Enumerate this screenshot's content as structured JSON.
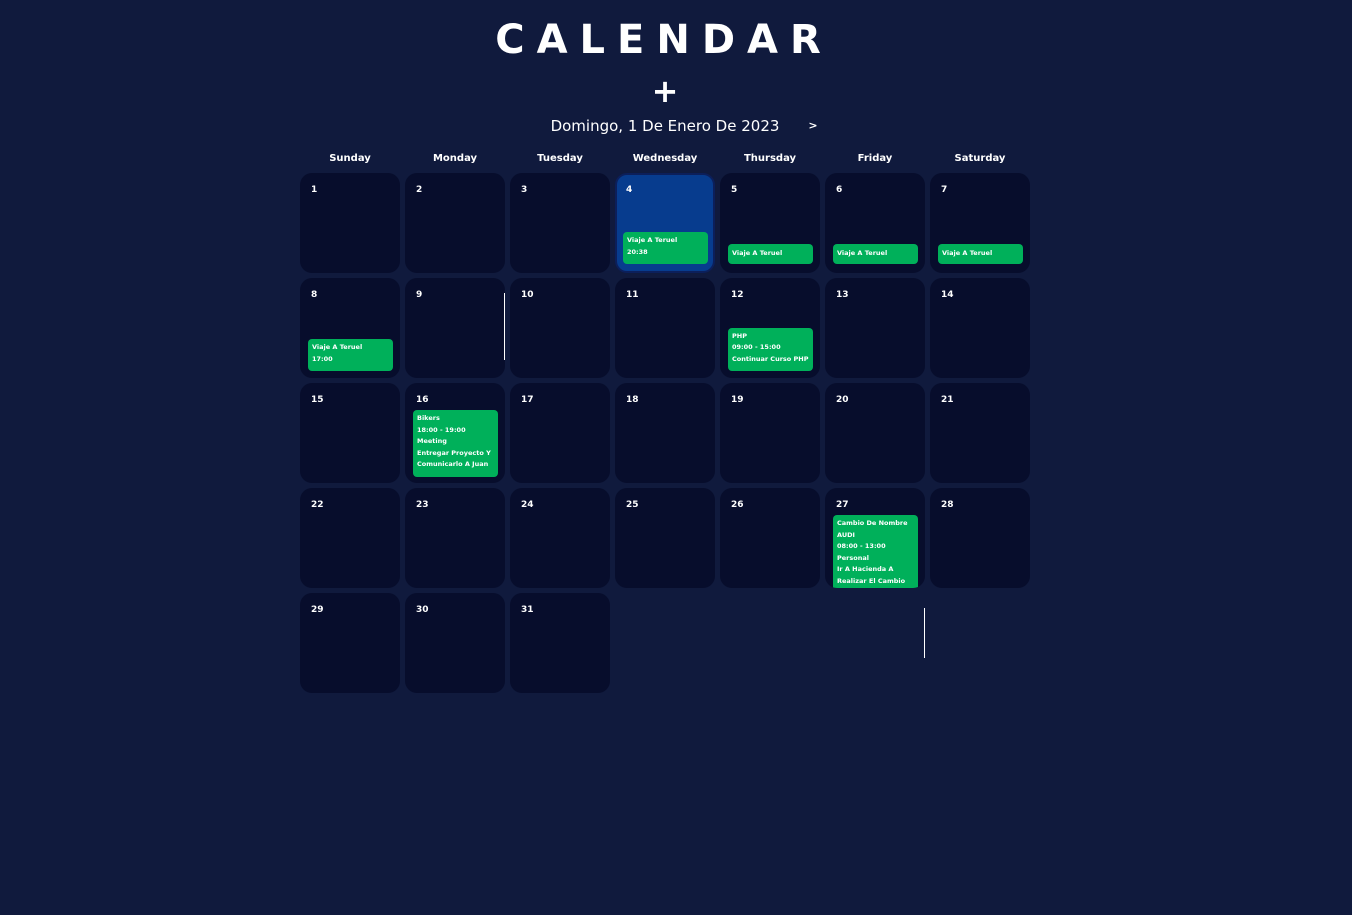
{
  "title": "CALENDAR",
  "add_icon": "plus-icon",
  "add_label": "+",
  "current_date": "Domingo, 1 De Enero De 2023",
  "next_label": ">",
  "weekdays": [
    "Sunday",
    "Monday",
    "Tuesday",
    "Wednesday",
    "Thursday",
    "Friday",
    "Saturday"
  ],
  "colors": {
    "background": "#101a3d",
    "cell": "#070d2c",
    "today_cell": "#073c8e",
    "event": "#00b05a",
    "text": "#ffffff"
  },
  "today": 4,
  "days": [
    {
      "n": "1",
      "events": []
    },
    {
      "n": "2",
      "events": []
    },
    {
      "n": "3",
      "events": []
    },
    {
      "n": "4",
      "events": [
        [
          "Viaje A Teruel",
          "20:38"
        ]
      ]
    },
    {
      "n": "5",
      "events": [
        [
          "Viaje A Teruel"
        ]
      ]
    },
    {
      "n": "6",
      "events": [
        [
          "Viaje A Teruel"
        ]
      ]
    },
    {
      "n": "7",
      "events": [
        [
          "Viaje A Teruel"
        ]
      ]
    },
    {
      "n": "8",
      "events": [
        [
          "Viaje A Teruel",
          "17:00"
        ]
      ]
    },
    {
      "n": "9",
      "events": []
    },
    {
      "n": "10",
      "events": []
    },
    {
      "n": "11",
      "events": []
    },
    {
      "n": "12",
      "events": [
        [
          "PHP",
          "09:00 - 15:00",
          "Continuar Curso PHP"
        ]
      ]
    },
    {
      "n": "13",
      "events": []
    },
    {
      "n": "14",
      "events": []
    },
    {
      "n": "15",
      "events": []
    },
    {
      "n": "16",
      "events": [
        [
          "Bikers",
          "18:00 - 19:00",
          "Meeting",
          "Entregar Proyecto Y",
          "Comunicarlo A Juan"
        ]
      ]
    },
    {
      "n": "17",
      "events": []
    },
    {
      "n": "18",
      "events": []
    },
    {
      "n": "19",
      "events": []
    },
    {
      "n": "20",
      "events": []
    },
    {
      "n": "21",
      "events": []
    },
    {
      "n": "22",
      "events": []
    },
    {
      "n": "23",
      "events": []
    },
    {
      "n": "24",
      "events": []
    },
    {
      "n": "25",
      "events": []
    },
    {
      "n": "26",
      "events": []
    },
    {
      "n": "27",
      "events": [
        [
          "Cambio De Nombre",
          "AUDI",
          "08:00 - 13:00",
          "Personal",
          "Ir A Hacienda A",
          "Realizar El Cambio"
        ]
      ]
    },
    {
      "n": "28",
      "events": []
    },
    {
      "n": "29",
      "events": []
    },
    {
      "n": "30",
      "events": []
    },
    {
      "n": "31",
      "events": []
    }
  ]
}
